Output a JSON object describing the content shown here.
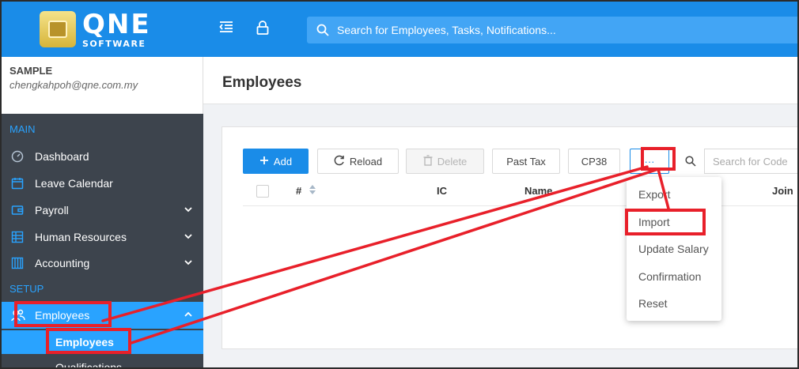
{
  "app": {
    "logo_main": "QNE",
    "logo_sub": "SOFTWARE",
    "search_placeholder": "Search for Employees, Tasks, Notifications..."
  },
  "user": {
    "company": "SAMPLE",
    "email": "chengkahpoh@qne.com.my"
  },
  "sidebar": {
    "main_label": "MAIN",
    "setup_label": "SETUP",
    "items": [
      {
        "label": "Dashboard",
        "icon": "dashboard-icon"
      },
      {
        "label": "Leave Calendar",
        "icon": "calendar-icon"
      },
      {
        "label": "Payroll",
        "icon": "wallet-icon",
        "expand": "chevron-down"
      },
      {
        "label": "Human Resources",
        "icon": "resources-icon",
        "expand": "chevron-down"
      },
      {
        "label": "Accounting",
        "icon": "accounting-icon",
        "expand": "chevron-down"
      },
      {
        "label": "Employees",
        "icon": "people-icon",
        "expand": "chevron-up",
        "active": true
      }
    ],
    "sub_items": [
      {
        "label": "Employees",
        "active": true
      },
      {
        "label": "Qualifications",
        "active": false
      }
    ]
  },
  "page": {
    "title": "Employees"
  },
  "toolbar": {
    "add": "Add",
    "reload": "Reload",
    "delete": "Delete",
    "past_tax": "Past Tax",
    "cp38": "CP38",
    "more": "···",
    "search_placeholder": "Search for Code"
  },
  "table": {
    "columns": [
      "#",
      "IC",
      "Name",
      "Join"
    ]
  },
  "more_menu": {
    "items": [
      "Export",
      "Import",
      "Update Salary",
      "Confirmation",
      "Reset"
    ]
  },
  "colors": {
    "brand": "#1a8ce8",
    "sidebar": "#3d444d",
    "active": "#29a3ff",
    "annotation": "#e8202a"
  }
}
